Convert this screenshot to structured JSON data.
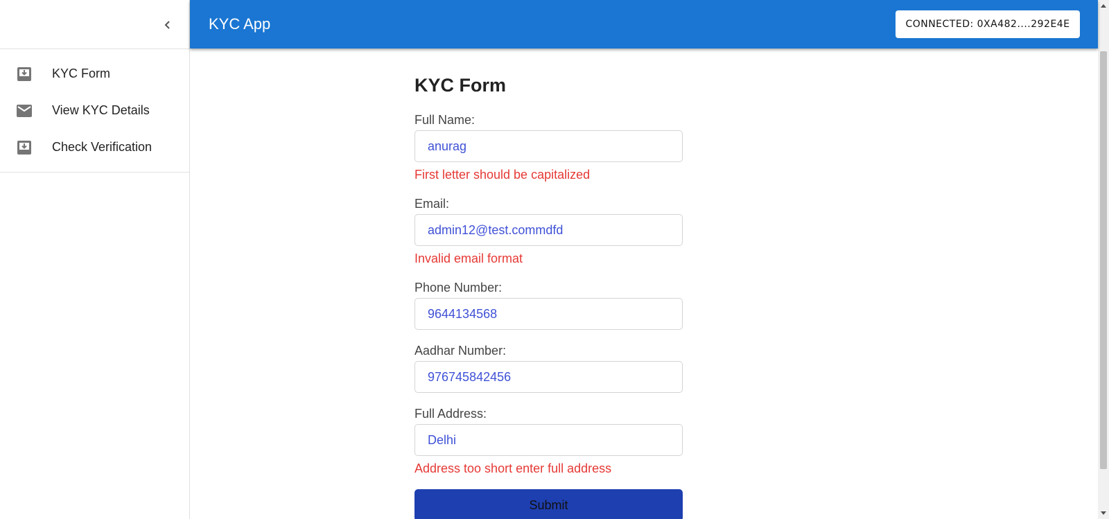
{
  "appbar": {
    "title": "KYC App",
    "connect_label": "CONNECTED: 0XA482....292E4E"
  },
  "sidebar": {
    "items": [
      {
        "label": "KYC Form",
        "icon": "move-to-inbox-icon"
      },
      {
        "label": "View KYC Details",
        "icon": "mail-icon"
      },
      {
        "label": "Check Verification",
        "icon": "move-to-inbox-icon"
      }
    ]
  },
  "form": {
    "title": "KYC Form",
    "full_name": {
      "label": "Full Name:",
      "value": "anurag",
      "error": "First letter should be capitalized"
    },
    "email": {
      "label": "Email:",
      "value": "admin12@test.commdfd",
      "error": "Invalid email format"
    },
    "phone": {
      "label": "Phone Number:",
      "value": "9644134568"
    },
    "aadhar": {
      "label": "Aadhar Number:",
      "value": "976745842456"
    },
    "address": {
      "label": "Full Address:",
      "value": "Delhi",
      "error": "Address too short enter full address"
    },
    "submit_label": "Submit"
  },
  "colors": {
    "appbar": "#1a76d2",
    "error": "#e53935",
    "input_text": "#3f51d6",
    "submit": "#1e3fb0"
  }
}
